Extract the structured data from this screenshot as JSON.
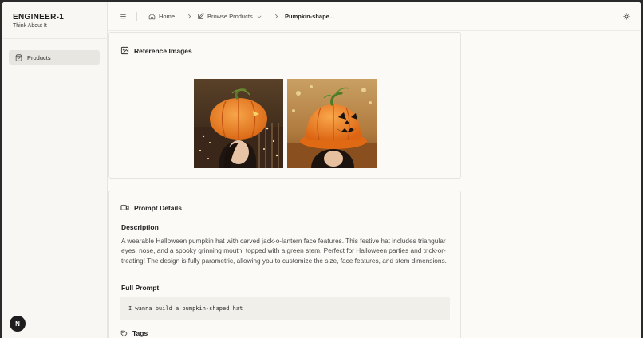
{
  "sidebar": {
    "brand_title": "ENGINEER-1",
    "brand_subtitle": "Think About It",
    "items": [
      {
        "label": "Products",
        "icon": "shopping-bag-icon"
      }
    ],
    "avatar_letter": "N"
  },
  "header": {
    "menu_icon": "menu-icon",
    "breadcrumbs": [
      {
        "label": "Home",
        "icon": "home-icon"
      },
      {
        "label": "Browse Products",
        "icon": "edit-icon",
        "has_dropdown": true
      },
      {
        "label": "Pumpkin-shape..."
      }
    ],
    "theme_icon": "sun-icon"
  },
  "reference_images": {
    "title": "Reference Images",
    "icon": "image-icon",
    "images": [
      {
        "name": "pumpkin-hat-photo-1"
      },
      {
        "name": "pumpkin-hat-photo-2"
      }
    ]
  },
  "prompt_details": {
    "title": "Prompt Details",
    "icon": "video-icon",
    "description_heading": "Description",
    "description": "A wearable Halloween pumpkin hat with carved jack-o-lantern face features. This festive hat includes triangular eyes, nose, and a spooky grinning mouth, topped with a green stem. Perfect for Halloween parties and trick-or-treating! The design is fully parametric, allowing you to customize the size, face features, and stem dimensions.",
    "full_prompt_heading": "Full Prompt",
    "full_prompt": "I wanna build a pumpkin-shaped hat",
    "tags_heading": "Tags",
    "tags_icon": "tag-icon"
  },
  "colors": {
    "background": "#fbfaf7",
    "sidebar_active": "#e8e6e1",
    "prompt_box": "#f1efe9",
    "pumpkin": "#e8741c"
  }
}
